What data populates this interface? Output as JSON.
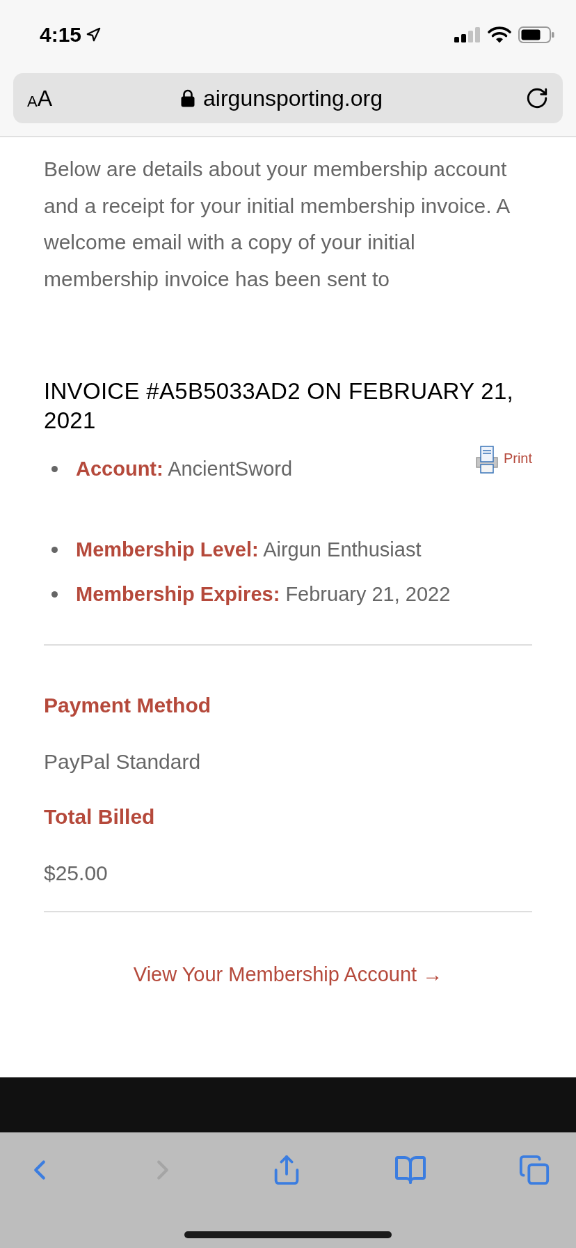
{
  "status_bar": {
    "time": "4:15"
  },
  "address_bar": {
    "text_size_label": "AA",
    "url": "airgunsporting.org"
  },
  "intro": "Below are details about your membership account and a receipt for your initial membership invoice. A welcome email with a copy of your initial membership invoice has been sent to",
  "invoice": {
    "title": "INVOICE #A5B5033AD2 ON FEBRUARY 21, 2021",
    "print_label": "Print",
    "details": [
      {
        "label": "Account:",
        "value": "AncientSword"
      },
      {
        "label": "Membership Level:",
        "value": "Airgun Enthusiast"
      },
      {
        "label": "Membership Expires:",
        "value": "February 21, 2022"
      }
    ]
  },
  "payment": [
    {
      "heading": "Payment Method",
      "value": "PayPal Standard"
    },
    {
      "heading": "Total Billed",
      "value": "$25.00"
    }
  ],
  "account_link": "View Your Membership Account →",
  "toolbar": [
    {
      "kind": "back",
      "disabled": false
    },
    {
      "kind": "forward",
      "disabled": true
    },
    {
      "kind": "share",
      "disabled": false
    },
    {
      "kind": "bookmarks",
      "disabled": false
    },
    {
      "kind": "tabs",
      "disabled": false
    }
  ]
}
